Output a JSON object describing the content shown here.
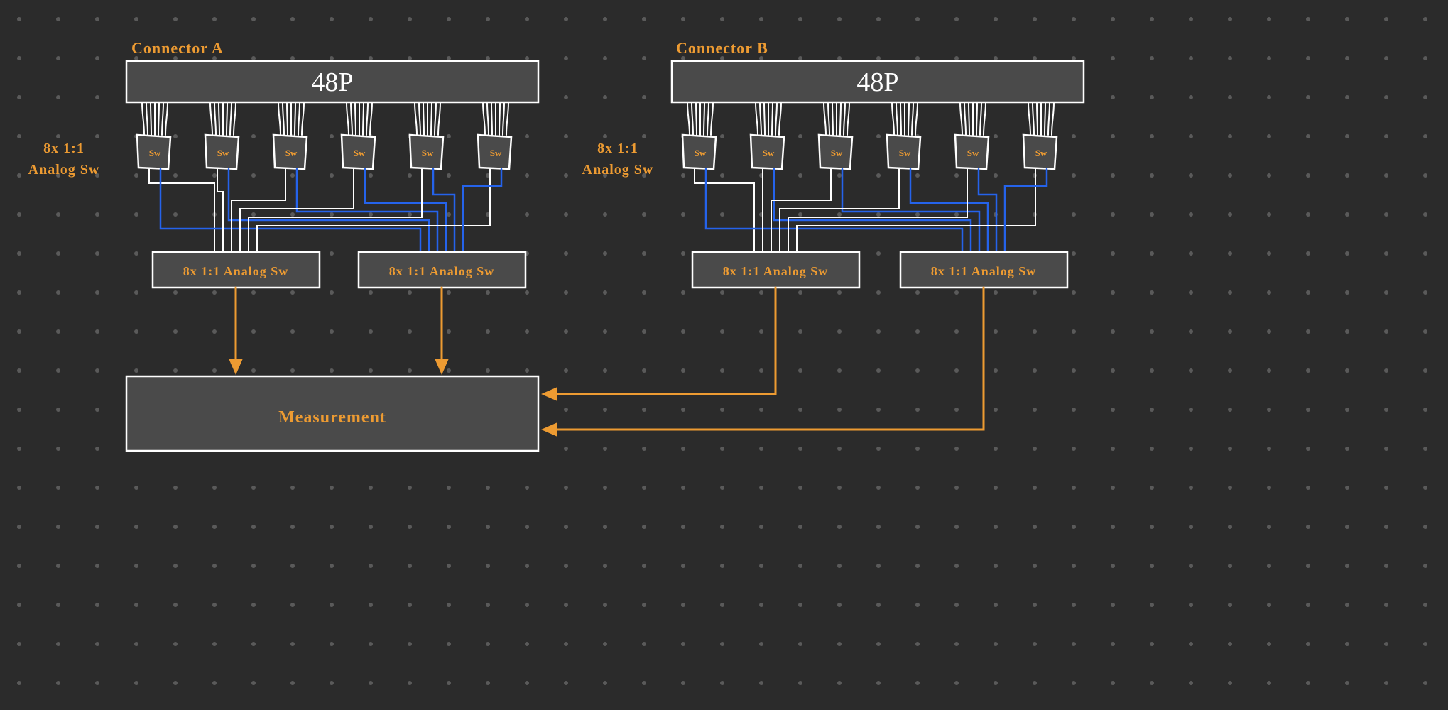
{
  "title_a": "Connector A",
  "title_b": "Connector B",
  "port_label": "48P",
  "side_label_line1": "8x 1:1",
  "side_label_line2": "Analog Sw",
  "sw_label": "Sw",
  "mux_label": "8x 1:1 Analog Sw",
  "measurement_label": "Measurement",
  "colors": {
    "bg": "#2b2b2b",
    "box": "#4a4a4a",
    "accent": "#ed9b32",
    "wire_blue": "#2563eb",
    "wire_white": "#ffffff"
  },
  "structure": {
    "connectors": [
      {
        "name": "A",
        "ports": 48,
        "first_stage_switches": 6,
        "first_stage_type": "8x 1:1 Analog Sw",
        "second_stage_switches": 2,
        "second_stage_type": "8x 1:1 Analog Sw",
        "output": "Measurement"
      },
      {
        "name": "B",
        "ports": 48,
        "first_stage_switches": 6,
        "first_stage_type": "8x 1:1 Analog Sw",
        "second_stage_switches": 2,
        "second_stage_type": "8x 1:1 Analog Sw",
        "output": "Measurement"
      }
    ],
    "measurement_inputs": 4
  }
}
